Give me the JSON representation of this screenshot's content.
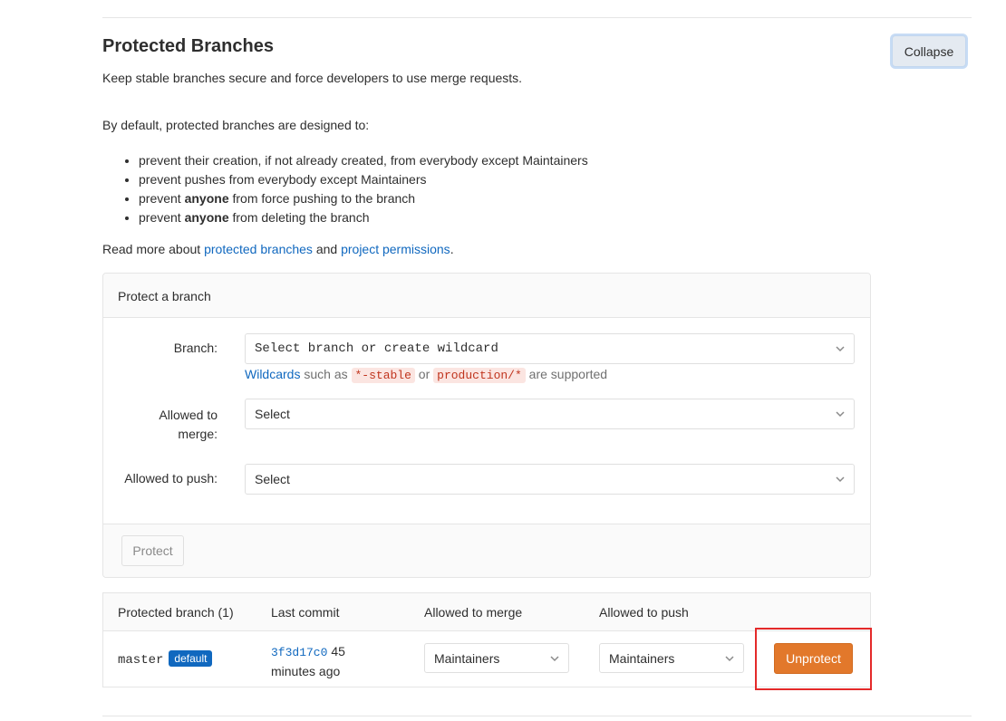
{
  "section": {
    "title": "Protected Branches",
    "collapse_label": "Collapse",
    "description": "Keep stable branches secure and force developers to use merge requests.",
    "intro": "By default, protected branches are designed to:",
    "rules": [
      {
        "pre": "prevent their creation, if not already created, from everybody except Maintainers",
        "bold": "",
        "post": ""
      },
      {
        "pre": "prevent pushes from everybody except Maintainers",
        "bold": "",
        "post": ""
      },
      {
        "pre": "prevent ",
        "bold": "anyone",
        "post": " from force pushing to the branch"
      },
      {
        "pre": "prevent ",
        "bold": "anyone",
        "post": " from deleting the branch"
      }
    ],
    "read_more": {
      "prefix": "Read more about ",
      "link1": "protected branches",
      "middle": " and ",
      "link2": "project permissions",
      "suffix": "."
    }
  },
  "protect_form": {
    "heading": "Protect a branch",
    "branch_label": "Branch:",
    "branch_placeholder": "Select branch or create wildcard",
    "hint": {
      "link": "Wildcards",
      "text1": " such as ",
      "code1": "*-stable",
      "text2": " or ",
      "code2": "production/*",
      "text3": " are supported"
    },
    "merge_label_line1": "Allowed to",
    "merge_label_line2": "merge:",
    "merge_value": "Select",
    "push_label": "Allowed to push:",
    "push_value": "Select",
    "protect_button": "Protect"
  },
  "table": {
    "headers": {
      "branch": "Protected branch (1)",
      "commit": "Last commit",
      "merge": "Allowed to merge",
      "push": "Allowed to push"
    },
    "rows": [
      {
        "branch": "master",
        "badge": "default",
        "sha": "3f3d17c0",
        "time_line1": "45",
        "time_line2": "minutes ago",
        "merge": "Maintainers",
        "push": "Maintainers",
        "action": "Unprotect"
      }
    ]
  },
  "colors": {
    "link": "#1068bf",
    "unprotect": "#e2782b",
    "highlight": "#e42a2a"
  }
}
